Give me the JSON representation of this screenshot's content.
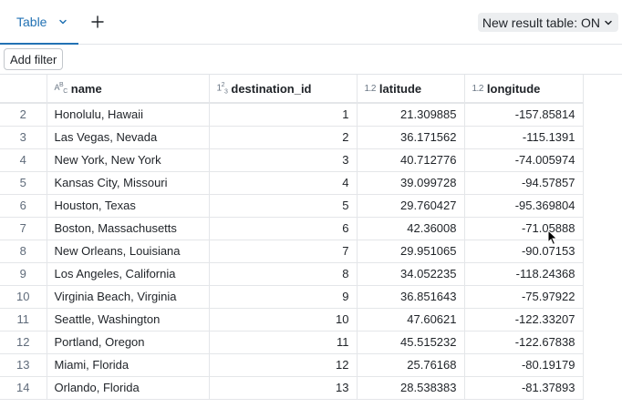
{
  "tabbar": {
    "active_tab_label": "Table",
    "add_tab_symbol": "+",
    "result_toggle_label": "New result table: ON"
  },
  "filter": {
    "add_filter_label": "Add filter"
  },
  "table": {
    "columns": [
      {
        "type_icon": "ABC",
        "label": "name"
      },
      {
        "type_icon": "123",
        "label": "destination_id"
      },
      {
        "type_icon": "1.2",
        "label": "latitude"
      },
      {
        "type_icon": "1.2",
        "label": "longitude"
      }
    ],
    "rows": [
      {
        "row": "2",
        "name": "Honolulu, Hawaii",
        "destination_id": "1",
        "latitude": "21.309885",
        "longitude": "-157.85814"
      },
      {
        "row": "3",
        "name": "Las Vegas, Nevada",
        "destination_id": "2",
        "latitude": "36.171562",
        "longitude": "-115.1391"
      },
      {
        "row": "4",
        "name": "New York, New York",
        "destination_id": "3",
        "latitude": "40.712776",
        "longitude": "-74.005974"
      },
      {
        "row": "5",
        "name": "Kansas City, Missouri",
        "destination_id": "4",
        "latitude": "39.099728",
        "longitude": "-94.57857"
      },
      {
        "row": "6",
        "name": "Houston, Texas",
        "destination_id": "5",
        "latitude": "29.760427",
        "longitude": "-95.369804"
      },
      {
        "row": "7",
        "name": "Boston, Massachusetts",
        "destination_id": "6",
        "latitude": "42.36008",
        "longitude": "-71.05888"
      },
      {
        "row": "8",
        "name": "New Orleans, Louisiana",
        "destination_id": "7",
        "latitude": "29.951065",
        "longitude": "-90.07153"
      },
      {
        "row": "9",
        "name": "Los Angeles, California",
        "destination_id": "8",
        "latitude": "34.052235",
        "longitude": "-118.24368"
      },
      {
        "row": "10",
        "name": "Virginia Beach, Virginia",
        "destination_id": "9",
        "latitude": "36.851643",
        "longitude": "-75.97922"
      },
      {
        "row": "11",
        "name": "Seattle, Washington",
        "destination_id": "10",
        "latitude": "47.60621",
        "longitude": "-122.33207"
      },
      {
        "row": "12",
        "name": "Portland, Oregon",
        "destination_id": "11",
        "latitude": "45.515232",
        "longitude": "-122.67838"
      },
      {
        "row": "13",
        "name": "Miami, Florida",
        "destination_id": "12",
        "latitude": "25.76168",
        "longitude": "-80.19179"
      },
      {
        "row": "14",
        "name": "Orlando, Florida",
        "destination_id": "13",
        "latitude": "28.538383",
        "longitude": "-81.37893"
      }
    ]
  },
  "colors": {
    "accent": "#2272b4",
    "grid_line": "#e4e6e9",
    "toggle_bg": "#eceef0"
  }
}
